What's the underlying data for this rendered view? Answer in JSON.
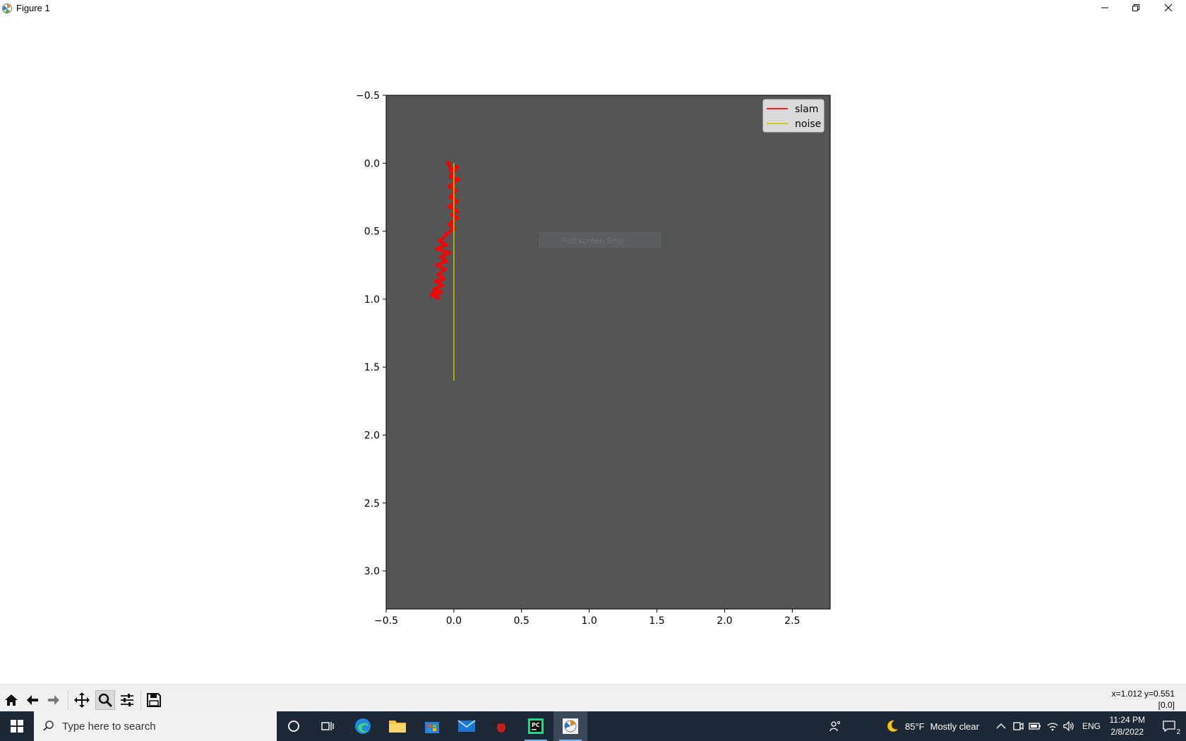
{
  "window": {
    "title": "Figure 1",
    "controls": [
      "minimize",
      "restore",
      "close"
    ]
  },
  "figure": {
    "watermark": "Full screen Snip",
    "colors": {
      "axes_background": "#555555",
      "slam": "#ff0000",
      "noise": "#c8c800"
    }
  },
  "chart_data": {
    "type": "line",
    "title": "",
    "xlabel": "",
    "ylabel": "",
    "xlim": [
      -0.5,
      2.78
    ],
    "ylim": [
      3.28,
      -0.5
    ],
    "y_inverted": true,
    "grid": false,
    "xticks": [
      "−0.5",
      "0.0",
      "0.5",
      "1.0",
      "1.5",
      "2.0",
      "2.5"
    ],
    "xtick_values": [
      -0.5,
      0.0,
      0.5,
      1.0,
      1.5,
      2.0,
      2.5
    ],
    "yticks": [
      "−0.5",
      "0.0",
      "0.5",
      "1.0",
      "1.5",
      "2.0",
      "2.5",
      "3.0"
    ],
    "ytick_values": [
      -0.5,
      0.0,
      0.5,
      1.0,
      1.5,
      2.0,
      2.5,
      3.0
    ],
    "legend": {
      "placement": "top-right",
      "entries": [
        "slam",
        "noise"
      ]
    },
    "series": [
      {
        "name": "slam",
        "color": "#ff0000",
        "x": [
          -0.04,
          -0.02,
          0.02,
          -0.02,
          0.03,
          -0.03,
          0.01,
          -0.02,
          0.02,
          -0.03,
          0.02,
          -0.01,
          0.02,
          -0.03,
          0.0,
          -0.05,
          -0.1,
          -0.06,
          -0.12,
          -0.04,
          -0.09,
          -0.06,
          -0.12,
          -0.07,
          -0.11,
          -0.08,
          -0.13,
          -0.09,
          -0.14,
          -0.1,
          -0.16,
          -0.12,
          -0.15
        ],
        "y": [
          0.0,
          0.05,
          0.03,
          0.1,
          0.12,
          0.17,
          0.2,
          0.25,
          0.28,
          0.32,
          0.35,
          0.38,
          0.4,
          0.45,
          0.48,
          0.52,
          0.57,
          0.6,
          0.63,
          0.66,
          0.69,
          0.72,
          0.75,
          0.78,
          0.82,
          0.85,
          0.87,
          0.9,
          0.93,
          0.95,
          0.97,
          0.99,
          0.96
        ]
      },
      {
        "name": "noise",
        "color": "#c8c800",
        "x": [
          0.0,
          0.0
        ],
        "y": [
          0.0,
          1.6
        ]
      }
    ]
  },
  "toolbar": {
    "buttons": [
      {
        "name": "home-button",
        "icon": "home-icon"
      },
      {
        "name": "back-button",
        "icon": "arrow-left-icon"
      },
      {
        "name": "forward-button",
        "icon": "arrow-right-icon"
      },
      {
        "name": "pan-button",
        "icon": "move-icon"
      },
      {
        "name": "zoom-button",
        "icon": "magnifier-icon"
      },
      {
        "name": "configure-subplots-button",
        "icon": "sliders-icon"
      },
      {
        "name": "save-button",
        "icon": "floppy-icon"
      }
    ],
    "coords": "x=1.012 y=0.551",
    "pixel_value": "[0.0]"
  },
  "taskbar": {
    "search_placeholder": "Type here to search",
    "weather_temp": "85°F",
    "weather_text": "Mostly clear",
    "language": "ENG",
    "time": "11:24 PM",
    "date": "2/8/2022",
    "notification_count": "2"
  }
}
